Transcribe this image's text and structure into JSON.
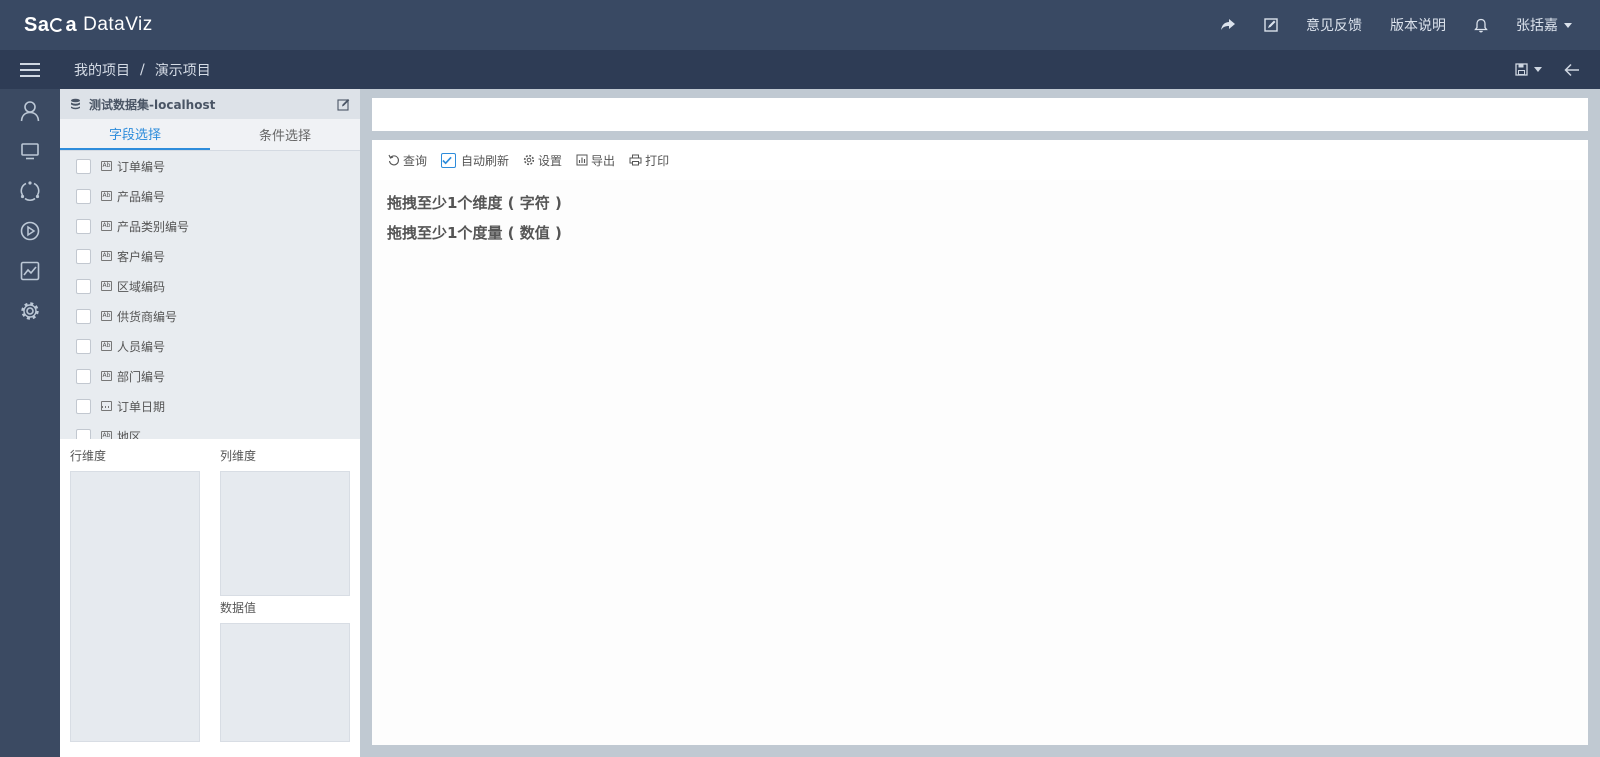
{
  "header": {
    "logo_mark": [
      "Sa",
      "a"
    ],
    "logo_name": "DataViz",
    "feedback": "意见反馈",
    "release_notes": "版本说明",
    "user": "张括嘉"
  },
  "breadcrumb": {
    "root": "我的项目",
    "separator": "/",
    "current": "演示项目"
  },
  "panel": {
    "dataset_title": "测试数据集-localhost",
    "tabs": [
      "字段选择",
      "条件选择"
    ],
    "fields": [
      {
        "label": "订单编号",
        "type": "text"
      },
      {
        "label": "产品编号",
        "type": "text"
      },
      {
        "label": "产品类别编号",
        "type": "text"
      },
      {
        "label": "客户编号",
        "type": "text"
      },
      {
        "label": "区域编码",
        "type": "text"
      },
      {
        "label": "供货商编号",
        "type": "text"
      },
      {
        "label": "人员编号",
        "type": "text"
      },
      {
        "label": "部门编号",
        "type": "text"
      },
      {
        "label": "订单日期",
        "type": "date"
      },
      {
        "label": "地区",
        "type": "text"
      }
    ],
    "icon_text": "Ab",
    "zones": {
      "rows": "行维度",
      "columns": "列维度",
      "values": "数据值"
    }
  },
  "toolbar": {
    "query": "查询",
    "auto_refresh": "自动刷新",
    "auto_refresh_checked": true,
    "settings": "设置",
    "export": "导出",
    "print": "打印"
  },
  "canvas": {
    "hint_dimension": "拖拽至少1个维度 ( 字符 )",
    "hint_measure": "拖拽至少1个度量 ( 数值 )"
  },
  "colors": {
    "topbar": "#394963",
    "subbar": "#2e3c55",
    "rail": "#3b4a62",
    "accent": "#2d8cdb"
  }
}
